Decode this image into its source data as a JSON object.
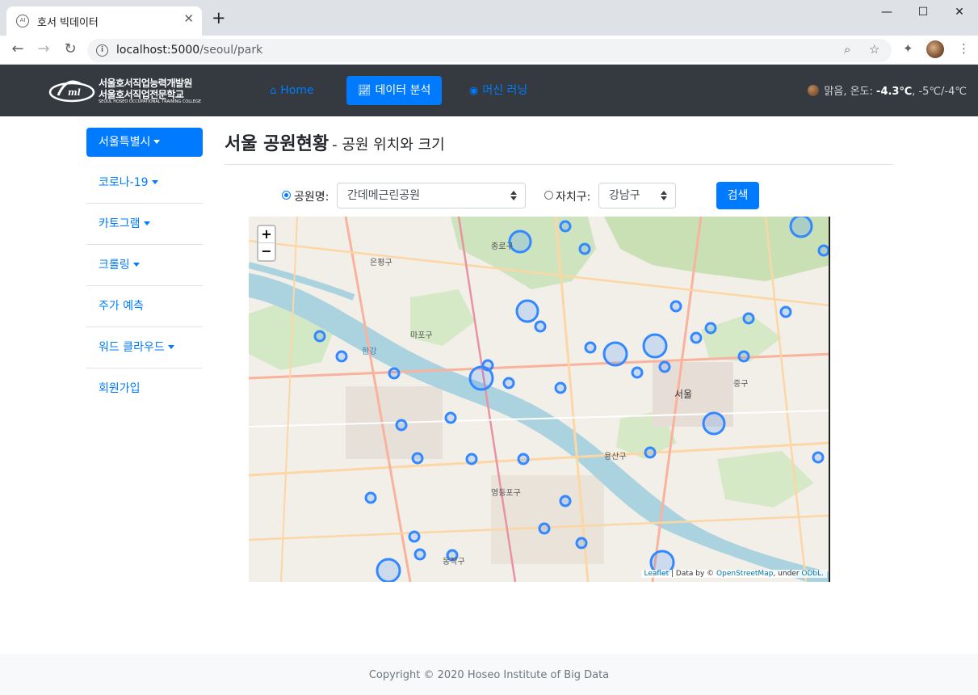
{
  "browser": {
    "tab_title": "호서 빅데이터",
    "tab_favicon": "AI",
    "new_tab_icon": "plus-icon",
    "url_host": "localhost:5000",
    "url_path": "/seoul/park"
  },
  "navbar": {
    "logo_line1": "서울호서직업능력개발원",
    "logo_line2": "서울호서직업전문학교",
    "logo_line3": "SEOUL HOSEO OCCUPATIONAL TRAINING COLLEGE",
    "items": [
      {
        "label": "Home",
        "icon": "home-icon"
      },
      {
        "label": "데이터 분석",
        "icon": "chart-icon"
      },
      {
        "label": "머신 러닝",
        "icon": "brain-icon"
      }
    ],
    "weather": {
      "condition": "맑음",
      "temp_label": "온도:",
      "temp": "-4.3℃",
      "range": "-5℃/-4℃"
    }
  },
  "sidebar": {
    "items": [
      {
        "label": "서울특별시",
        "dropdown": true
      },
      {
        "label": "코로나-19",
        "dropdown": true
      },
      {
        "label": "카토그램",
        "dropdown": true
      },
      {
        "label": "크롤링",
        "dropdown": true
      },
      {
        "label": "주가 예측",
        "dropdown": false
      },
      {
        "label": "워드 클라우드",
        "dropdown": true
      },
      {
        "label": "회원가입",
        "dropdown": false
      }
    ]
  },
  "main": {
    "title": "서울 공원현황",
    "subtitle": "- 공원 위치와 크기",
    "form": {
      "park_label": "공원명:",
      "park_value": "간데메근린공원",
      "district_label": "자치구:",
      "district_value": "강남구",
      "search_label": "검색"
    }
  },
  "map": {
    "zoom_in": "+",
    "zoom_out": "−",
    "attribution_leaflet": "Leaflet",
    "attribution_data": " | Data by © ",
    "attribution_osm": "OpenStreetMap",
    "attribution_under": ", under ",
    "attribution_odbl": "ODbL.",
    "labels": [
      "종로구",
      "서울",
      "마포구",
      "용산구",
      "한강",
      "영등포구",
      "은평구",
      "중구",
      "동작구"
    ],
    "park_marker_color": "#3388ff"
  },
  "footer": {
    "copyright": "Copyright © 2020 Hoseo Institute of Big Data"
  }
}
